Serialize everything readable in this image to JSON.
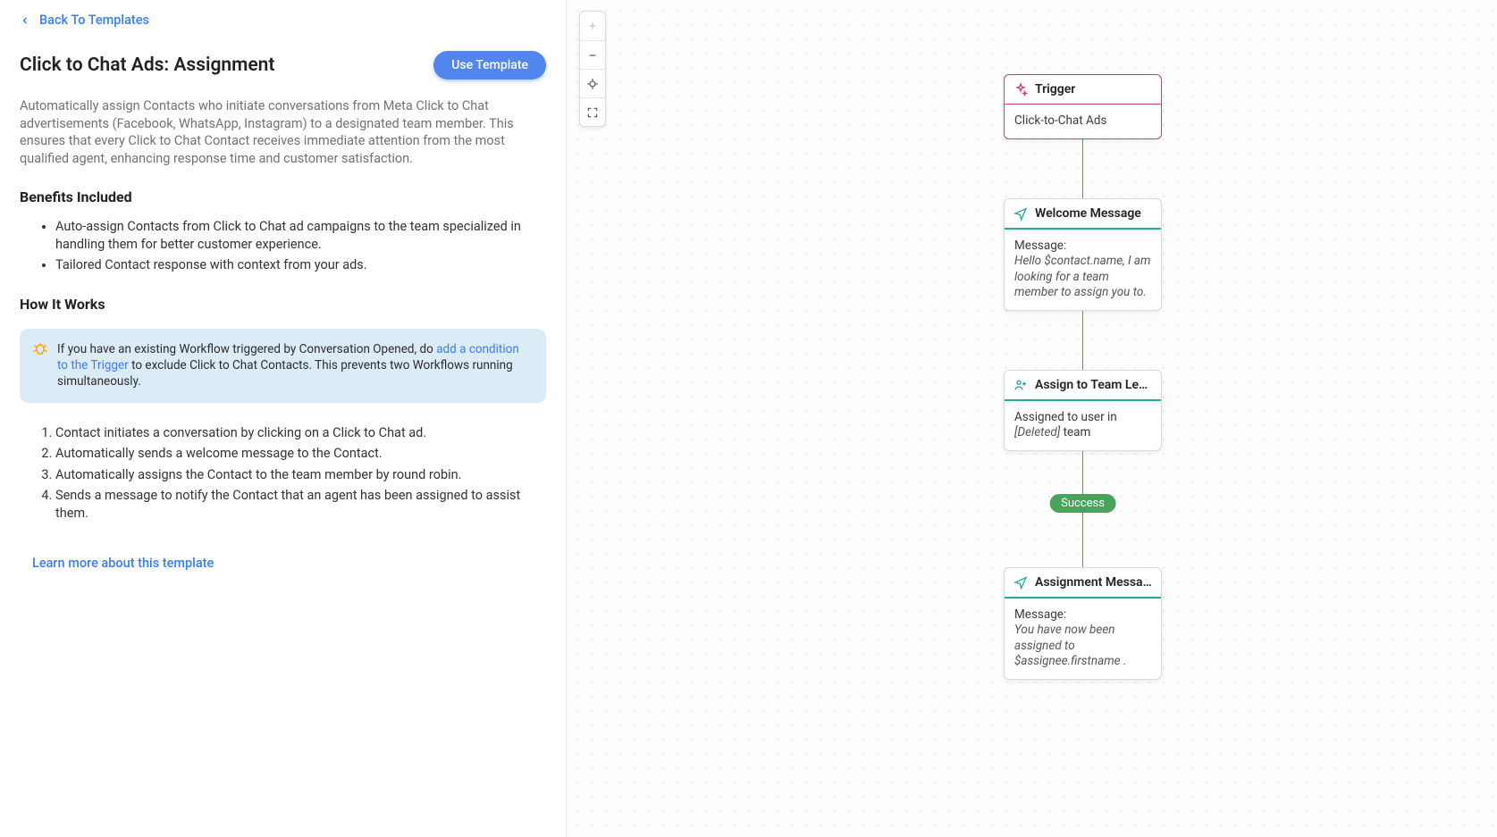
{
  "colors": {
    "accent": "#3a7df5",
    "trigger": "#d13c7e",
    "teal": "#22a79b",
    "success": "#46a55a",
    "noteBg": "#dbecf7"
  },
  "back_label": "Back To Templates",
  "header": {
    "title": "Click to Chat Ads: Assignment",
    "use_template": "Use Template"
  },
  "description": "Automatically assign Contacts who initiate conversations from Meta Click to Chat advertisements (Facebook, WhatsApp, Instagram) to a designated team member. This ensures that every Click to Chat Contact receives immediate attention from the most qualified agent, enhancing response time and customer satisfaction.",
  "benefits_heading": "Benefits Included",
  "benefits": [
    "Auto-assign Contacts from Click to Chat ad campaigns to the team specialized in handling them for better customer experience.",
    "Tailored Contact response with context from your ads."
  ],
  "how_heading": "How It Works",
  "note": {
    "pre": "If you have an existing Workflow triggered by Conversation Opened, do ",
    "link": "add a condition to the Trigger",
    "post": " to exclude Click to Chat Contacts. This prevents two Workflows running simultaneously."
  },
  "steps": [
    "Contact initiates a conversation by clicking on a Click to Chat ad.",
    "Automatically sends a welcome message to the Contact.",
    "Automatically assigns the Contact to the team member by round robin.",
    "Sends a message to notify the Contact that an agent has been assigned to assist them."
  ],
  "learn_more": "Learn more about this template",
  "flow": {
    "trigger": {
      "title": "Trigger",
      "body": "Click-to-Chat Ads"
    },
    "welcome": {
      "title": "Welcome Message",
      "label": "Message:",
      "body": "Hello $contact.name, I am looking for a team member to assign you to."
    },
    "assign": {
      "title": "Assign to Team Least C…",
      "pre": "Assigned to user in ",
      "deleted": "[Deleted]",
      "post": " team"
    },
    "success_badge": "Success",
    "assignment": {
      "title": "Assignment Message",
      "label": "Message:",
      "body": "You have now been assigned to $assignee.firstname ."
    }
  },
  "zoom_icons": {
    "plus": "plus-icon",
    "minus": "minus-icon",
    "center": "crosshair-icon",
    "full": "fullscreen-icon"
  }
}
